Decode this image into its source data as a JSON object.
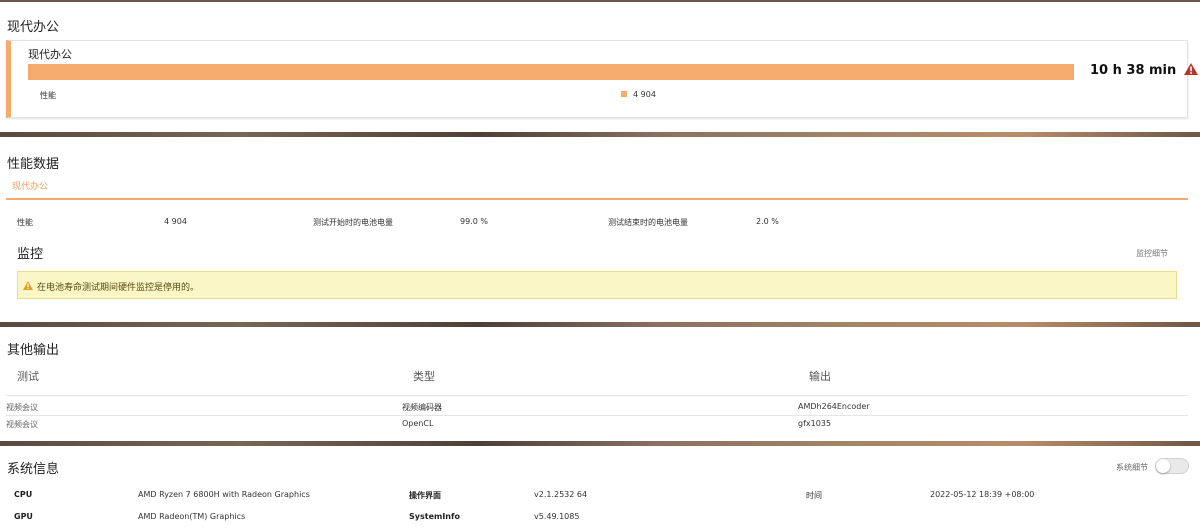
{
  "battery_summary": {
    "section_title": "现代办公",
    "card_title": "现代办公",
    "duration": "10 h 38 min",
    "legend_label": "性能",
    "legend_value": "4 904",
    "bar_color": "#f6ab6e",
    "icon": "warning-icon"
  },
  "performance": {
    "section_title": "性能数据",
    "tab_label": "现代办公",
    "score_label": "性能",
    "score_value": "4 904",
    "start_battery_label": "测试开始时的电池电量",
    "start_battery_value": "99.0 %",
    "end_battery_label": "测试结束时的电池电量",
    "end_battery_value": "2.0 %"
  },
  "monitoring": {
    "title": "监控",
    "details_link": "监控细节",
    "alert_text": "在电池寿命测试期间硬件监控是停用的。"
  },
  "other_output": {
    "section_title": "其他输出",
    "columns": [
      "测试",
      "类型",
      "输出"
    ],
    "rows": [
      {
        "test": "视频会议",
        "type": "视频编码器",
        "output": "AMDh264Encoder"
      },
      {
        "test": "视频会议",
        "type": "OpenCL",
        "output": "gfx1035"
      }
    ]
  },
  "system_info": {
    "section_title": "系统信息",
    "toggle_label": "系统细节",
    "toggle_on": false,
    "cpu_label": "CPU",
    "cpu_value": "AMD Ryzen 7 6800H with Radeon Graphics",
    "gpu_label": "GPU",
    "gpu_value": "AMD Radeon(TM) Graphics",
    "os_ui_label": "操作界面",
    "os_ui_value": "v2.1.2532 64",
    "sysinfo_label": "SystemInfo",
    "sysinfo_value": "v5.49.1085",
    "time_label": "时间",
    "time_value": "2022-05-12 18:39 +08:00"
  }
}
